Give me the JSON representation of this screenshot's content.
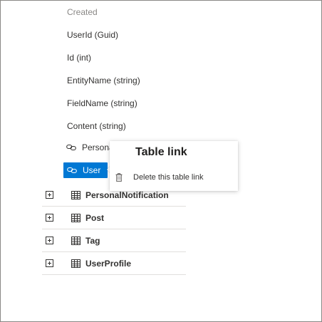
{
  "entity": {
    "fields": [
      {
        "label": "Created",
        "faded": true
      },
      {
        "label": "UserId (Guid)",
        "faded": false
      },
      {
        "label": "Id (int)",
        "faded": false
      },
      {
        "label": "EntityName (string)",
        "faded": false
      },
      {
        "label": "FieldName (string)",
        "faded": false
      },
      {
        "label": "Content (string)",
        "faded": false
      }
    ],
    "links": [
      {
        "label": "PersonalNotification",
        "selected": false
      },
      {
        "label": "User",
        "selected": true
      }
    ]
  },
  "tables": [
    {
      "name": "PersonalNotification"
    },
    {
      "name": "Post"
    },
    {
      "name": "Tag"
    },
    {
      "name": "UserProfile"
    }
  ],
  "popup": {
    "title": "Table link",
    "action_label": "Delete this table link",
    "action_icon": "trash-icon"
  },
  "colors": {
    "accent": "#0078d4",
    "text": "#323130",
    "muted": "#8a8886",
    "divider": "#e1dfdd"
  }
}
